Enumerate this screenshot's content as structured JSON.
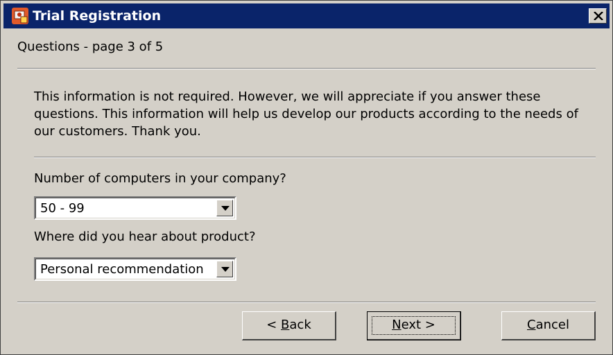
{
  "window": {
    "title": "Trial Registration",
    "icon": "app-icon",
    "close_icon": "close-icon"
  },
  "page": {
    "subtitle": "Questions - page 3 of 5",
    "intro_text": "This information is not required. However, we will appreciate if you answer these questions. This information will help us develop our products according to the needs of our customers. Thank you."
  },
  "questions": [
    {
      "label": "Number of computers in your company?",
      "selected": "50 - 99"
    },
    {
      "label": "Where did you hear about product?",
      "selected": "Personal recommendation"
    }
  ],
  "buttons": {
    "back": {
      "prefix": "< ",
      "mnemonic": "B",
      "rest": "ack"
    },
    "next": {
      "mnemonic": "N",
      "rest": "ext >"
    },
    "cancel": {
      "mnemonic": "C",
      "rest": "ancel"
    }
  },
  "colors": {
    "titlebar": "#0a246a",
    "face": "#d4d0c8",
    "title_text": "#ffffff"
  }
}
